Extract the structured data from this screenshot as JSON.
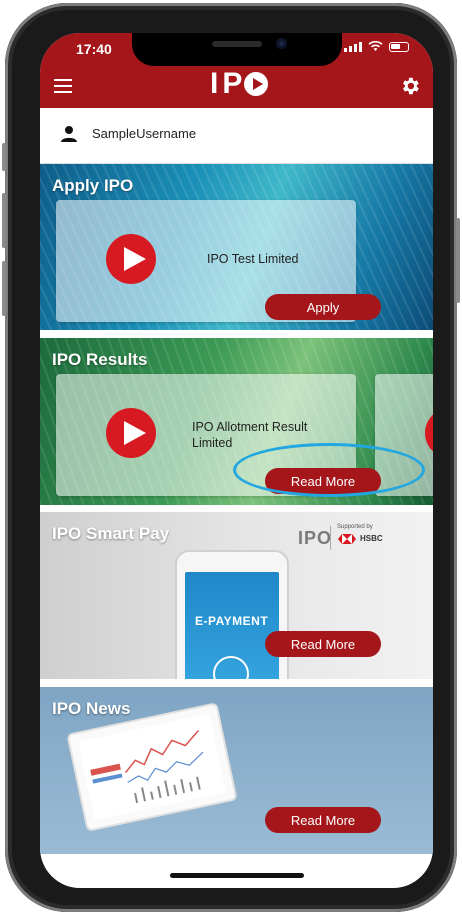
{
  "status": {
    "time": "17:40"
  },
  "header": {
    "logo_text": "IP",
    "menu_icon": "hamburger-menu-icon",
    "settings_icon": "gear-icon"
  },
  "user": {
    "name": "SampleUsername",
    "icon": "person-icon"
  },
  "apply_ipo": {
    "title": "Apply IPO",
    "card": {
      "name": "IPO Test Limited",
      "button": "Apply"
    }
  },
  "ipo_results": {
    "title": "IPO Results",
    "card": {
      "name_line1": "IPO Allotment Result",
      "name_line2": "Limited",
      "button": "Read More"
    }
  },
  "smart_pay": {
    "title": "IPO Smart Pay",
    "illustration_text": "E-PAYMENT",
    "brand": "IPO",
    "supported_by": "Supported by",
    "partner": "HSBC",
    "button": "Read More"
  },
  "news": {
    "title": "IPO News",
    "button": "Read More"
  },
  "colors": {
    "brand_red": "#a4161a",
    "play_red": "#d71a21",
    "highlight": "#22a7e0"
  }
}
